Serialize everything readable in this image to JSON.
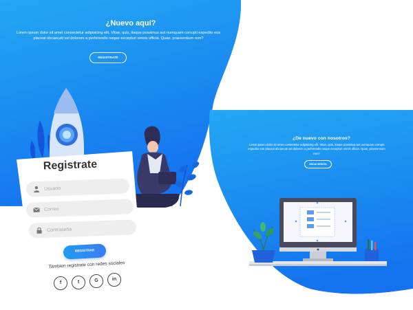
{
  "sign_up_panel": {
    "title": "¿Nuevo aquí?",
    "description": "Lorem ipsum dolor sit amet consectetur adipisicing elit. Vitae, quis, itaque possimus aut numquam corrupti expedito eos placeat obcaecati vel dolorem a perferendis neque excepturi omnis officia. Quae, praesentium rem?",
    "button_label": "REGISTRATE"
  },
  "sign_in_panel": {
    "title": "¿De nuevo con nosotros?",
    "description": "Lorem ipsum dolor sit amet consectetur adipisicing elit. Vitae, quis, itaque possimus aut numquam corrupti expedito eos placeat obcaecati vel dolorem a perferendis neque excepturi omnis officia. Quae, praesentium rem?",
    "button_label": "INICIA SESIÓN"
  },
  "form": {
    "title": "Registrate",
    "fields": [
      {
        "placeholder": "Usuario",
        "icon": "user-icon"
      },
      {
        "placeholder": "Correo",
        "icon": "envelope-icon"
      },
      {
        "placeholder": "Contraseña",
        "icon": "lock-icon"
      }
    ],
    "submit_label": "REGISTRAR",
    "social_label": "Tambien registrate con redes sociales",
    "social": [
      {
        "label": "f",
        "icon": "facebook-icon"
      },
      {
        "label": "t",
        "icon": "twitter-icon"
      },
      {
        "label": "G",
        "icon": "google-icon"
      },
      {
        "label": "in",
        "icon": "linkedin-icon"
      }
    ]
  },
  "colors": {
    "primary_gradient_start": "#1fa3f2",
    "primary_gradient_end": "#1570ef",
    "card": "#ffffff",
    "field_bg": "#eeeeee",
    "text_dark": "#333333"
  }
}
